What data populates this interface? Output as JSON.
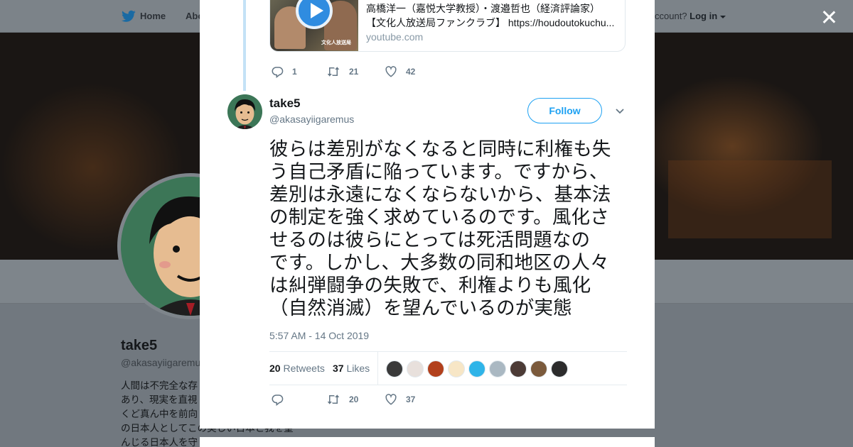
{
  "topbar": {
    "home_label": "Home",
    "about_label": "Abo",
    "account_prompt": "ccount?",
    "login_label": "Log in"
  },
  "profile": {
    "name": "take5",
    "handle": "@akasayiigaremus",
    "bio_lines": [
      "人間は不完全な存",
      "あり、現実を直視",
      "くど真ん中を前向",
      "の日本人としてこの美しい日本と我を望",
      "んじる日本人を守"
    ]
  },
  "previous_tweet": {
    "card": {
      "title": "高橋洋一（嘉悦大学教授）・渡邉哲也（経済評論家）",
      "description": "【文化人放送局ファンクラブ】 https://houdoutokuchu...",
      "domain": "youtube.com",
      "thumb_caption": "文化人放送局"
    },
    "replies": "1",
    "retweets": "21",
    "likes": "42"
  },
  "tweet": {
    "name": "take5",
    "handle": "@akasayiigaremus",
    "follow_label": "Follow",
    "text_lines": [
      "彼らは差別がなくなると同時に利権も失",
      "う自己矛盾に陥っています。ですから、",
      "差別は永遠になくならないから、基本法",
      "の制定を強く求めているのです。風化さ",
      "せるのは彼らにとっては死活問題なの",
      "です。しかし、大多数の同和地区の人々",
      "は糾弾闘争の失敗で、利権よりも風化",
      "（自然消滅）を望んでいるのが実態"
    ],
    "timestamp": "5:57 AM - 14 Oct 2019",
    "retweet_count": "20",
    "retweet_label": "Retweets",
    "like_count": "37",
    "like_label": "Likes",
    "actions": {
      "replies": "",
      "retweets": "20",
      "likes": "37"
    }
  },
  "colors": {
    "accent": "#1da1f2",
    "thread_line": "#c4e2f6",
    "muted_text": "#657786"
  }
}
